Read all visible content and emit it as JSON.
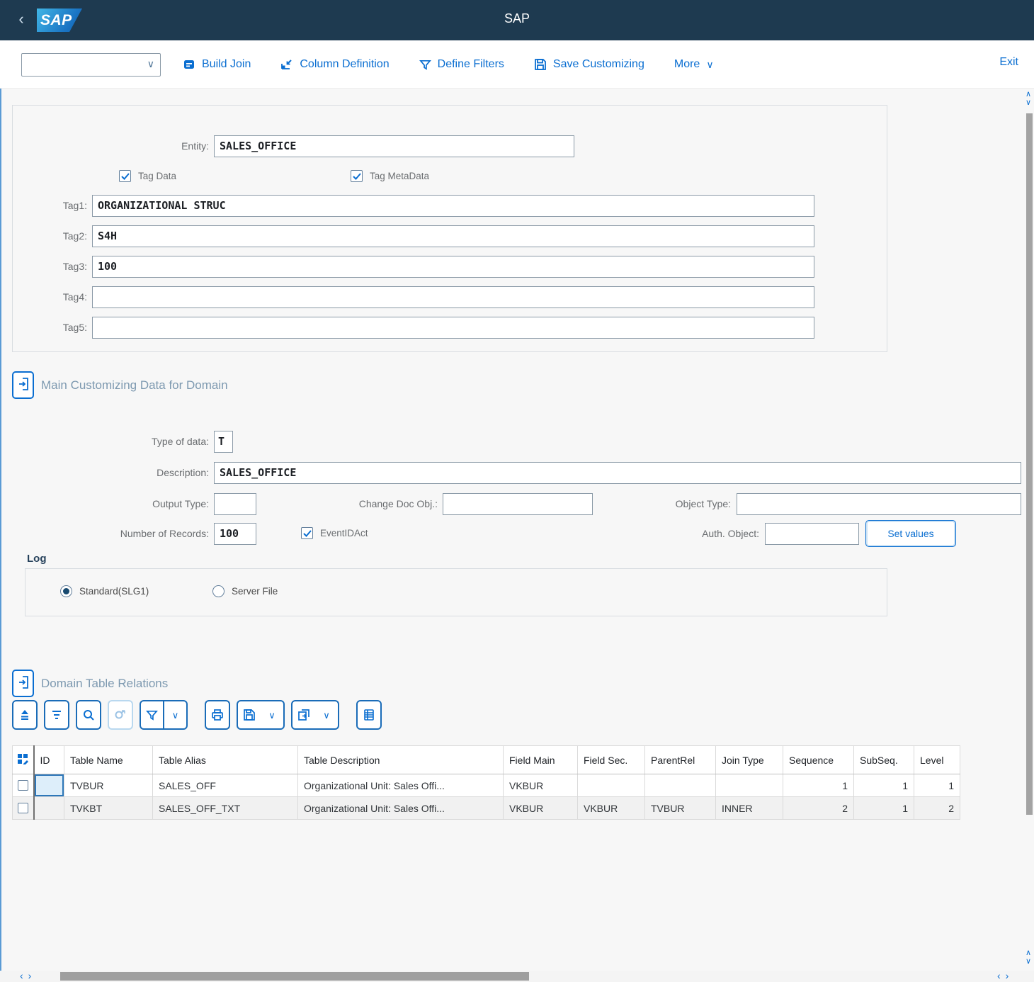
{
  "colors": {
    "accent": "#0a6ed1",
    "shell_bg": "#1e3a50"
  },
  "icons": {
    "back": "‹",
    "chevron_down": "∨",
    "chevron_up": "∧",
    "chevron_left": "‹",
    "chevron_right": "›"
  },
  "shell": {
    "title": "SAP",
    "logo_text": "SAP"
  },
  "toolbar": {
    "combo_value": "",
    "actions": [
      {
        "label": "Build Join"
      },
      {
        "label": "Column Definition"
      },
      {
        "label": "Define Filters"
      },
      {
        "label": "Save Customizing"
      }
    ],
    "more_label": "More",
    "exit_label": "Exit"
  },
  "entity_form": {
    "entity_label": "Entity:",
    "entity_value": "SALES_OFFICE",
    "tag_data_label": "Tag Data",
    "tag_metadata_label": "Tag MetaData",
    "tags": [
      {
        "label": "Tag1:",
        "value": "ORGANIZATIONAL STRUC"
      },
      {
        "label": "Tag2:",
        "value": "S4H"
      },
      {
        "label": "Tag3:",
        "value": "100"
      },
      {
        "label": "Tag4:",
        "value": ""
      },
      {
        "label": "Tag5:",
        "value": ""
      }
    ]
  },
  "customizing": {
    "title": "Main Customizing Data for Domain",
    "type_of_data_label": "Type of data:",
    "type_of_data_value": "T",
    "description_label": "Description:",
    "description_value": "SALES_OFFICE",
    "output_type_label": "Output Type:",
    "output_type_value": "",
    "change_doc_label": "Change Doc Obj.:",
    "change_doc_value": "",
    "object_type_label": "Object Type:",
    "object_type_value": "",
    "number_of_records_label": "Number of Records:",
    "number_of_records_value": "100",
    "event_id_act_label": "EventIDAct",
    "auth_object_label": "Auth. Object:",
    "auth_object_value": "",
    "set_values_label": "Set values"
  },
  "log": {
    "title": "Log",
    "standard_label": "Standard(SLG1)",
    "server_file_label": "Server File"
  },
  "relations": {
    "title": "Domain Table Relations",
    "columns": [
      "ID",
      "Table Name",
      "Table Alias",
      "Table Description",
      "Field Main",
      "Field Sec.",
      "ParentRel",
      "Join Type",
      "Sequence",
      "SubSeq.",
      "Level"
    ],
    "rows": [
      {
        "id": "",
        "table_name": "TVBUR",
        "table_alias": "SALES_OFF",
        "description": "Organizational Unit: Sales Offi...",
        "field_main": "VKBUR",
        "field_sec": "",
        "parent_rel": "",
        "join_type": "",
        "sequence": "1",
        "subseq": "1",
        "level": "1"
      },
      {
        "id": "",
        "table_name": "TVKBT",
        "table_alias": "SALES_OFF_TXT",
        "description": "Organizational Unit: Sales Offi...",
        "field_main": "VKBUR",
        "field_sec": "VKBUR",
        "parent_rel": "TVBUR",
        "join_type": "INNER",
        "sequence": "2",
        "subseq": "1",
        "level": "2"
      }
    ]
  }
}
